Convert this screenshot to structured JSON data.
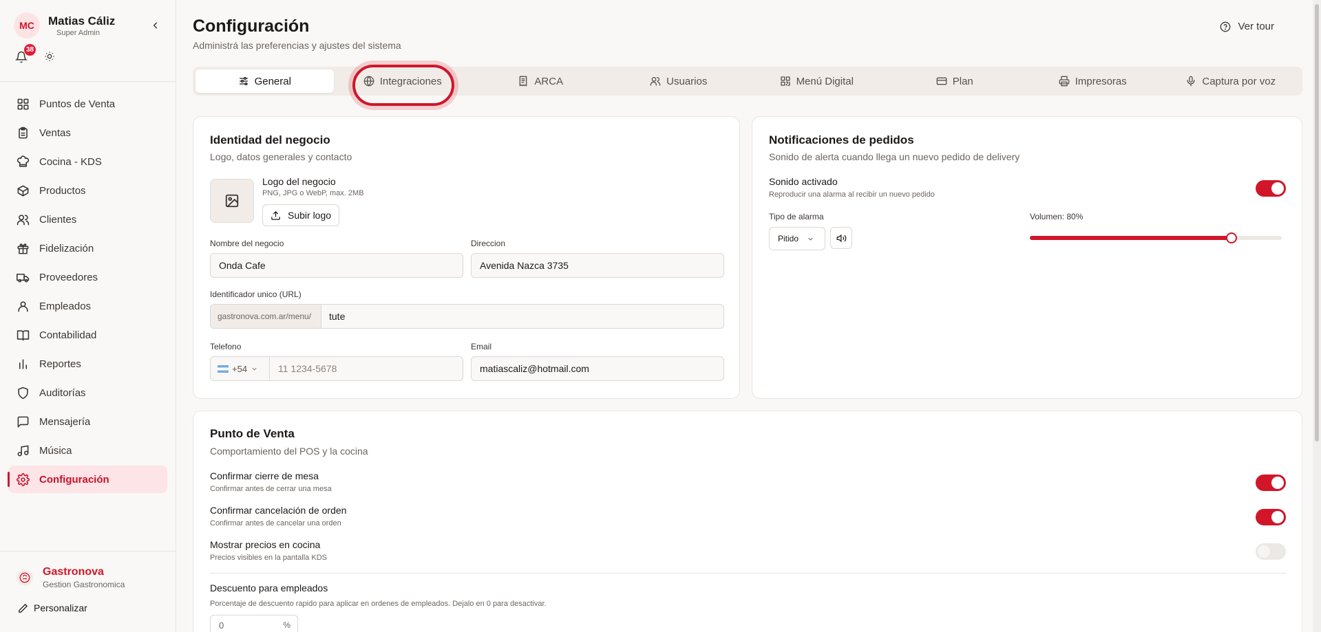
{
  "user": {
    "initials": "MC",
    "name": "Matias Cáliz",
    "role": "Super Admin",
    "notifications": "38"
  },
  "sidebar": {
    "items": [
      {
        "label": "Puntos de Venta",
        "icon": "grid-icon"
      },
      {
        "label": "Ventas",
        "icon": "clipboard-icon"
      },
      {
        "label": "Cocina - KDS",
        "icon": "chef-hat-icon"
      },
      {
        "label": "Productos",
        "icon": "package-icon"
      },
      {
        "label": "Clientes",
        "icon": "users-icon"
      },
      {
        "label": "Fidelización",
        "icon": "gift-icon"
      },
      {
        "label": "Proveedores",
        "icon": "truck-icon"
      },
      {
        "label": "Empleados",
        "icon": "user-icon"
      },
      {
        "label": "Contabilidad",
        "icon": "book-icon"
      },
      {
        "label": "Reportes",
        "icon": "bar-chart-icon"
      },
      {
        "label": "Auditorías",
        "icon": "shield-icon"
      },
      {
        "label": "Mensajería",
        "icon": "message-icon"
      },
      {
        "label": "Música",
        "icon": "music-icon"
      },
      {
        "label": "Configuración",
        "icon": "gear-icon"
      }
    ],
    "active_index": 13,
    "brand_name": "Gastronova",
    "brand_sub": "Gestion Gastronomica",
    "personalize": "Personalizar"
  },
  "header": {
    "title": "Configuración",
    "subtitle": "Administrá las preferencias y ajustes del sistema",
    "tour": "Ver tour"
  },
  "tabs": [
    {
      "label": "General",
      "icon": "sliders-icon"
    },
    {
      "label": "Integraciones",
      "icon": "globe-icon"
    },
    {
      "label": "ARCA",
      "icon": "receipt-icon"
    },
    {
      "label": "Usuarios",
      "icon": "users-icon"
    },
    {
      "label": "Menú Digital",
      "icon": "qr-icon"
    },
    {
      "label": "Plan",
      "icon": "credit-card-icon"
    },
    {
      "label": "Impresoras",
      "icon": "printer-icon"
    },
    {
      "label": "Captura por voz",
      "icon": "mic-icon"
    }
  ],
  "identity": {
    "title": "Identidad del negocio",
    "subtitle": "Logo, datos generales y contacto",
    "logo_label": "Logo del negocio",
    "logo_hint": "PNG, JPG o WebP, max. 2MB",
    "upload": "Subir logo",
    "name_label": "Nombre del negocio",
    "name_value": "Onda Cafe",
    "address_label": "Direccion",
    "address_value": "Avenida Nazca 3735",
    "slug_label": "Identificador unico (URL)",
    "slug_prefix": "gastronova.com.ar/menu/",
    "slug_value": "tute",
    "phone_label": "Telefono",
    "phone_code": "+54",
    "phone_placeholder": "11 1234-5678",
    "email_label": "Email",
    "email_value": "matiascaliz@hotmail.com"
  },
  "notifications": {
    "title": "Notificaciones de pedidos",
    "subtitle": "Sonido de alerta cuando llega un nuevo pedido de delivery",
    "sound_label": "Sonido activado",
    "sound_desc": "Reproducir una alarma al recibir un nuevo pedido",
    "sound_on": true,
    "alarm_label": "Tipo de alarma",
    "alarm_value": "Pitido",
    "volume_label": "Volumen: 80%",
    "volume": 0.8
  },
  "pos": {
    "title": "Punto de Venta",
    "subtitle": "Comportamiento del POS y la cocina",
    "settings": [
      {
        "label": "Confirmar cierre de mesa",
        "desc": "Confirmar antes de cerrar una mesa",
        "on": true
      },
      {
        "label": "Confirmar cancelación de orden",
        "desc": "Confirmar antes de cancelar una orden",
        "on": true
      },
      {
        "label": "Mostrar precios en cocina",
        "desc": "Precios visibles en la pantalla KDS",
        "on": false
      }
    ],
    "discount_label": "Descuento para empleados",
    "discount_desc": "Porcentaje de descuento rapido para aplicar en ordenes de empleados. Dejalo en 0 para desactivar.",
    "discount_value": "0",
    "discount_unit": "%"
  },
  "colors": {
    "accent": "#d1162a",
    "active_bg": "#fde4e6"
  }
}
